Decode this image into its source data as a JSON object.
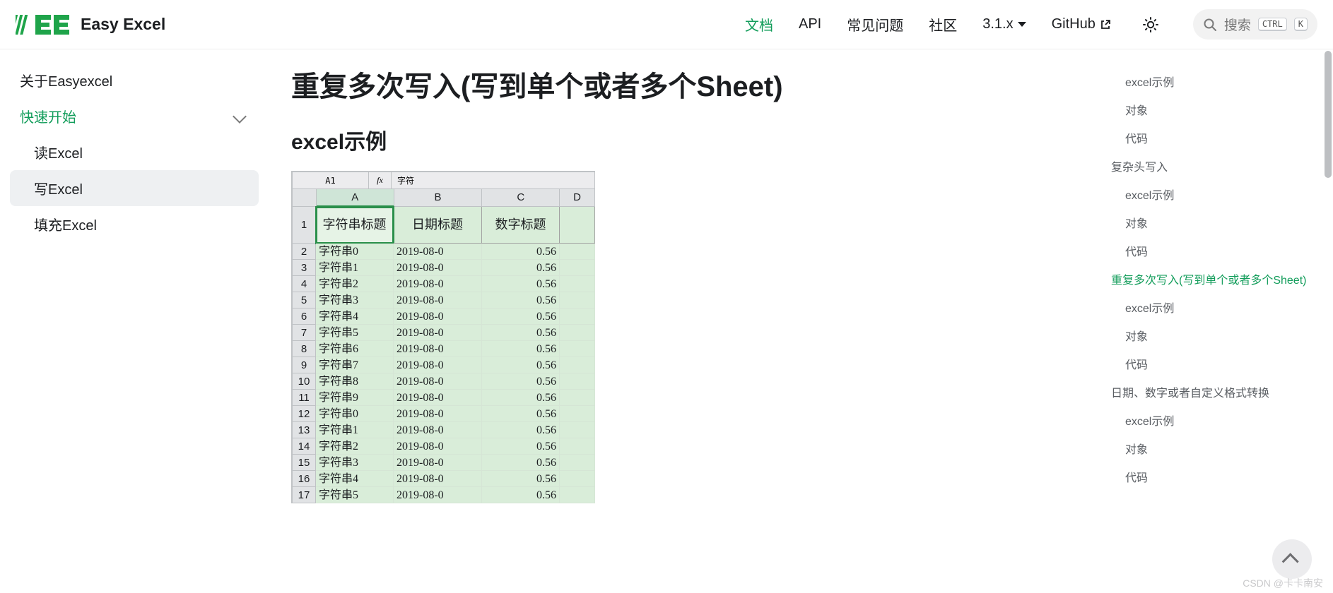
{
  "brand": {
    "name": "Easy Excel"
  },
  "nav": {
    "docs": "文档",
    "api": "API",
    "faq": "常见问题",
    "community": "社区",
    "version": "3.1.x",
    "github": "GitHub"
  },
  "search": {
    "placeholder": "搜索",
    "kbd1": "CTRL",
    "kbd2": "K"
  },
  "sidebar": {
    "items": [
      {
        "label": "关于Easyexcel"
      },
      {
        "label": "快速开始",
        "expanded": true
      },
      {
        "label": "读Excel"
      },
      {
        "label": "写Excel",
        "current": true
      },
      {
        "label": "填充Excel"
      }
    ]
  },
  "page": {
    "h1": "重复多次写入(写到单个或者多个Sheet)",
    "h2": "excel示例"
  },
  "excel": {
    "cell_ref": "A1",
    "fx_label": "fx",
    "fx_value": "字符",
    "cols": [
      "A",
      "B",
      "C",
      "D"
    ],
    "headers": [
      "字符串标题",
      "日期标题",
      "数字标题"
    ],
    "rows": [
      {
        "n": 2,
        "a": "字符串0",
        "b": "2019-08-0",
        "c": "0.56"
      },
      {
        "n": 3,
        "a": "字符串1",
        "b": "2019-08-0",
        "c": "0.56"
      },
      {
        "n": 4,
        "a": "字符串2",
        "b": "2019-08-0",
        "c": "0.56"
      },
      {
        "n": 5,
        "a": "字符串3",
        "b": "2019-08-0",
        "c": "0.56"
      },
      {
        "n": 6,
        "a": "字符串4",
        "b": "2019-08-0",
        "c": "0.56"
      },
      {
        "n": 7,
        "a": "字符串5",
        "b": "2019-08-0",
        "c": "0.56"
      },
      {
        "n": 8,
        "a": "字符串6",
        "b": "2019-08-0",
        "c": "0.56"
      },
      {
        "n": 9,
        "a": "字符串7",
        "b": "2019-08-0",
        "c": "0.56"
      },
      {
        "n": 10,
        "a": "字符串8",
        "b": "2019-08-0",
        "c": "0.56"
      },
      {
        "n": 11,
        "a": "字符串9",
        "b": "2019-08-0",
        "c": "0.56"
      },
      {
        "n": 12,
        "a": "字符串0",
        "b": "2019-08-0",
        "c": "0.56"
      },
      {
        "n": 13,
        "a": "字符串1",
        "b": "2019-08-0",
        "c": "0.56"
      },
      {
        "n": 14,
        "a": "字符串2",
        "b": "2019-08-0",
        "c": "0.56"
      },
      {
        "n": 15,
        "a": "字符串3",
        "b": "2019-08-0",
        "c": "0.56"
      },
      {
        "n": 16,
        "a": "字符串4",
        "b": "2019-08-0",
        "c": "0.56"
      },
      {
        "n": 17,
        "a": "字符串5",
        "b": "2019-08-0",
        "c": "0.56"
      }
    ]
  },
  "toc": [
    {
      "label": "excel示例",
      "level": 1
    },
    {
      "label": "对象",
      "level": 1
    },
    {
      "label": "代码",
      "level": 1
    },
    {
      "label": "复杂头写入",
      "level": 0
    },
    {
      "label": "excel示例",
      "level": 1
    },
    {
      "label": "对象",
      "level": 1
    },
    {
      "label": "代码",
      "level": 1
    },
    {
      "label": "重复多次写入(写到单个或者多个Sheet)",
      "level": 0,
      "active": true
    },
    {
      "label": "excel示例",
      "level": 1
    },
    {
      "label": "对象",
      "level": 1
    },
    {
      "label": "代码",
      "level": 1
    },
    {
      "label": "日期、数字或者自定义格式转换",
      "level": 0
    },
    {
      "label": "excel示例",
      "level": 1
    },
    {
      "label": "对象",
      "level": 1
    },
    {
      "label": "代码",
      "level": 1
    }
  ],
  "watermark": "CSDN @卡卡南安"
}
